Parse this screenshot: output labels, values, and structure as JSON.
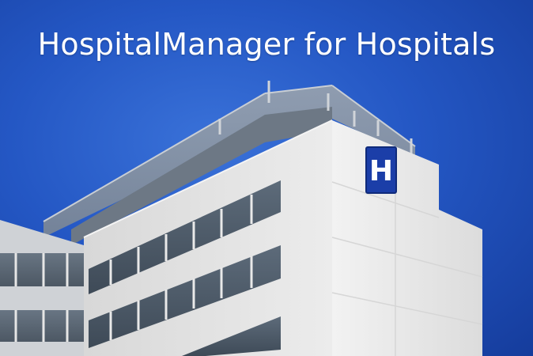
{
  "headline": {
    "text": "HospitalManager for Hospitals"
  },
  "building": {
    "sign_letter": "H"
  },
  "colors": {
    "sky_top": "#3a72d9",
    "sky_edge": "#153c9c",
    "sign_blue": "#1b3ea8",
    "facade": "#eaeaea"
  }
}
